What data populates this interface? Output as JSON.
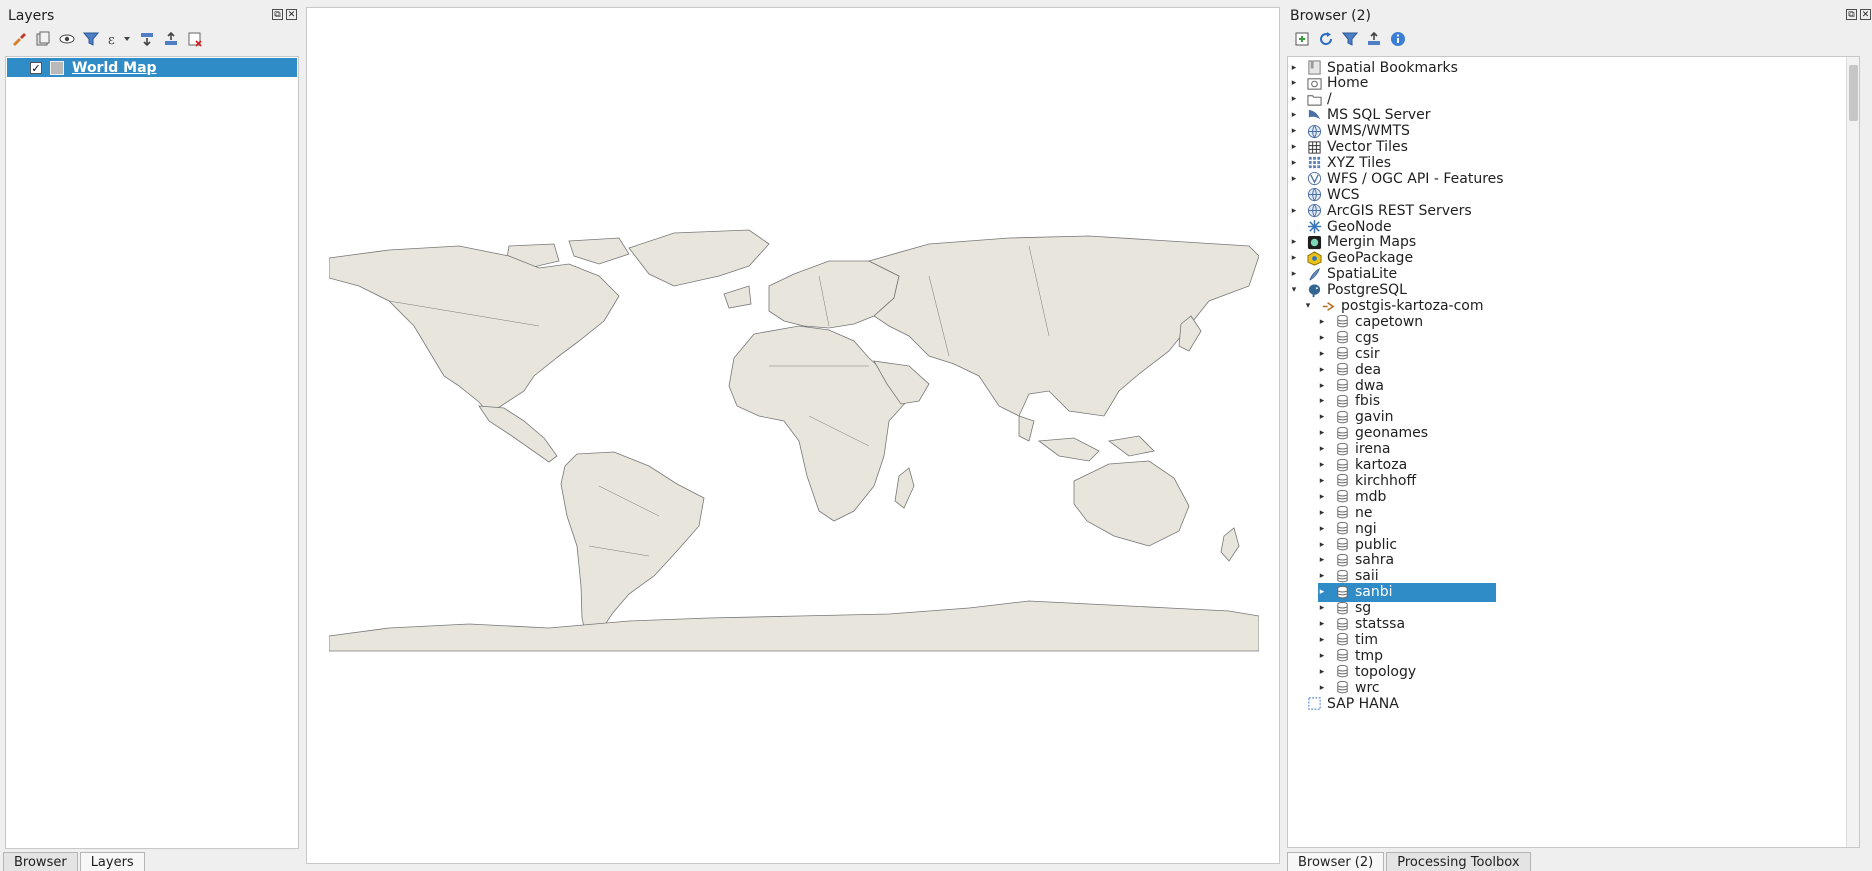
{
  "layers_panel": {
    "title": "Layers",
    "layers": [
      {
        "name": "World Map",
        "checked": true
      }
    ],
    "tabs": [
      "Browser",
      "Layers"
    ],
    "active_tab": "Layers"
  },
  "browser_panel": {
    "title": "Browser (2)",
    "tabs": [
      "Browser (2)",
      "Processing Toolbox"
    ],
    "active_tab": "Browser (2)",
    "tree": [
      {
        "label": "Spatial Bookmarks",
        "icon": "bookmark-icon"
      },
      {
        "label": "Home",
        "icon": "home-icon"
      },
      {
        "label": "/",
        "icon": "folder-icon"
      },
      {
        "label": "MS SQL Server",
        "icon": "mssql-icon"
      },
      {
        "label": "WMS/WMTS",
        "icon": "globe-icon"
      },
      {
        "label": "Vector Tiles",
        "icon": "grid-icon"
      },
      {
        "label": "XYZ Tiles",
        "icon": "tiles-icon"
      },
      {
        "label": "WFS / OGC API - Features",
        "icon": "wfs-icon"
      },
      {
        "label": "WCS",
        "icon": "globe-icon"
      },
      {
        "label": "ArcGIS REST Servers",
        "icon": "globe-icon"
      },
      {
        "label": "GeoNode",
        "icon": "geonode-icon"
      },
      {
        "label": "Mergin Maps",
        "icon": "mergin-icon"
      },
      {
        "label": "GeoPackage",
        "icon": "geopackage-icon"
      },
      {
        "label": "SpatiaLite",
        "icon": "feather-icon"
      },
      {
        "label": "PostgreSQL",
        "icon": "elephant-icon"
      },
      {
        "label": "postgis-kartoza-com",
        "icon": "connection-icon"
      },
      {
        "label": "capetown",
        "icon": "schema-icon"
      },
      {
        "label": "cgs",
        "icon": "schema-icon"
      },
      {
        "label": "csir",
        "icon": "schema-icon"
      },
      {
        "label": "dea",
        "icon": "schema-icon"
      },
      {
        "label": "dwa",
        "icon": "schema-icon"
      },
      {
        "label": "fbis",
        "icon": "schema-icon"
      },
      {
        "label": "gavin",
        "icon": "schema-icon"
      },
      {
        "label": "geonames",
        "icon": "schema-icon"
      },
      {
        "label": "irena",
        "icon": "schema-icon"
      },
      {
        "label": "kartoza",
        "icon": "schema-icon"
      },
      {
        "label": "kirchhoff",
        "icon": "schema-icon"
      },
      {
        "label": "mdb",
        "icon": "schema-icon"
      },
      {
        "label": "ne",
        "icon": "schema-icon"
      },
      {
        "label": "ngi",
        "icon": "schema-icon"
      },
      {
        "label": "public",
        "icon": "schema-icon"
      },
      {
        "label": "sahra",
        "icon": "schema-icon"
      },
      {
        "label": "saii",
        "icon": "schema-icon"
      },
      {
        "label": "sanbi",
        "icon": "schema-icon",
        "selected": true
      },
      {
        "label": "sg",
        "icon": "schema-icon"
      },
      {
        "label": "statssa",
        "icon": "schema-icon"
      },
      {
        "label": "tim",
        "icon": "schema-icon"
      },
      {
        "label": "tmp",
        "icon": "schema-icon"
      },
      {
        "label": "topology",
        "icon": "schema-icon"
      },
      {
        "label": "wrc",
        "icon": "schema-icon"
      },
      {
        "label": "SAP HANA",
        "icon": "hana-icon"
      }
    ]
  },
  "colors": {
    "selection": "#308cc6",
    "land_fill": "#e8e6dc",
    "land_stroke": "#777777"
  }
}
